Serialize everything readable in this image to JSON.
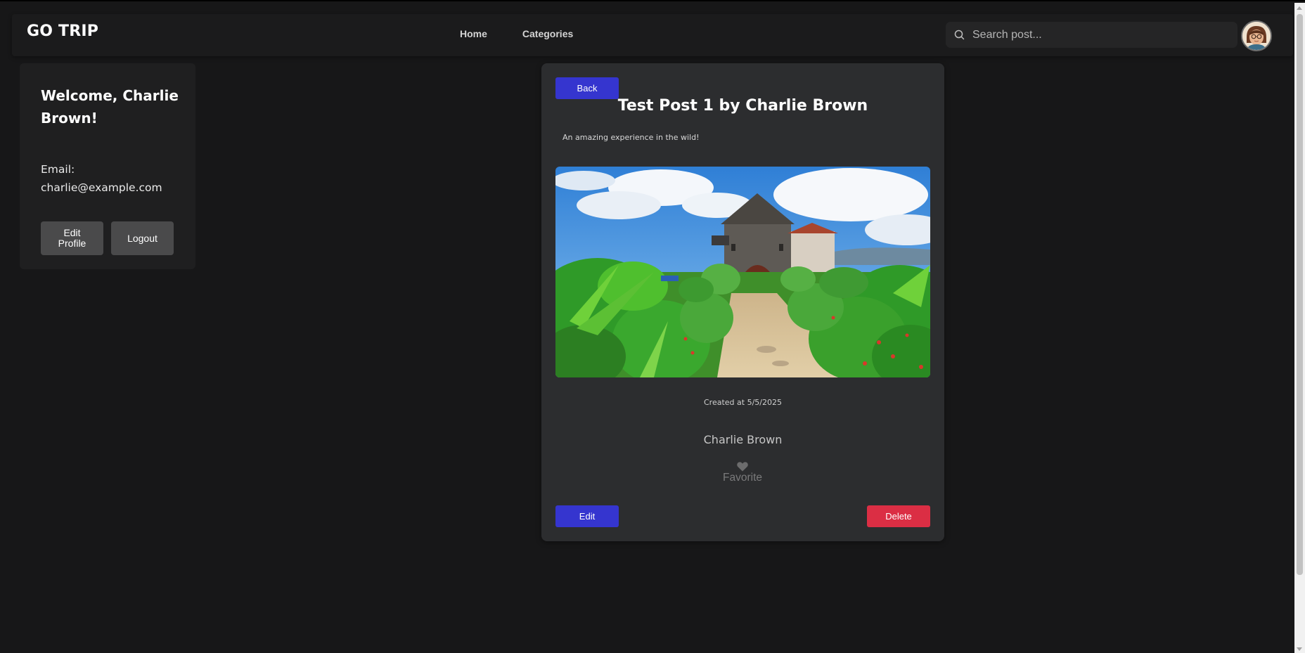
{
  "navbar": {
    "brand": "GO TRIP",
    "links": [
      {
        "label": "Home"
      },
      {
        "label": "Categories"
      }
    ],
    "search_placeholder": "Search post...",
    "search_value": ""
  },
  "sidebar": {
    "welcome": "Welcome, Charlie Brown!",
    "email_label": "Email:",
    "email_value": "charlie@example.com",
    "edit_profile_label": "Edit Profile",
    "logout_label": "Logout"
  },
  "post": {
    "back_label": "Back",
    "title": "Test Post 1 by Charlie Brown",
    "subtitle": "An amazing experience in the wild!",
    "created_at": "Created at 5/5/2025",
    "author": "Charlie Brown",
    "favorite_label": "Favorite",
    "edit_label": "Edit",
    "delete_label": "Delete"
  },
  "colors": {
    "background": "#171718",
    "card": "#2c2d2f",
    "primary_button": "#3535cf",
    "danger_button": "#db2e44",
    "secondary_button": "#4a4a4b"
  },
  "icons": {
    "search": "search-icon",
    "favorite": "heart-icon",
    "avatar": "avatar"
  }
}
